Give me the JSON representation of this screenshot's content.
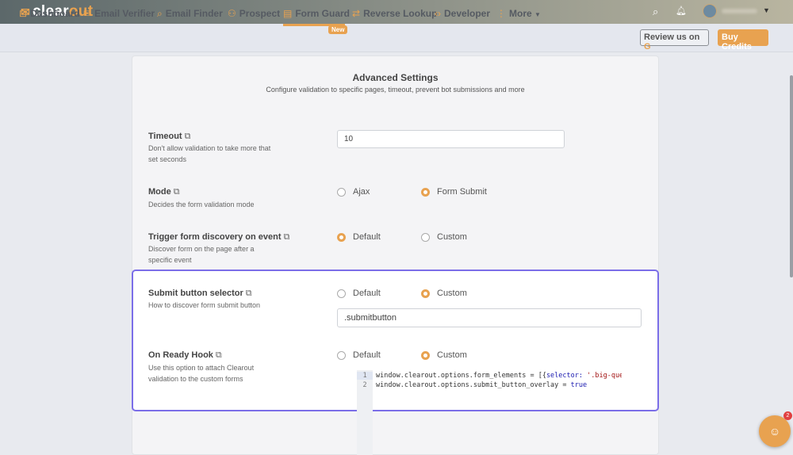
{
  "header": {
    "logo_a": "clear",
    "logo_b": "out",
    "search_icon": "search-icon",
    "bell_icon": "bell-icon"
  },
  "nav": {
    "items": [
      {
        "label": "Dashboard",
        "icon": "briefcase-icon"
      },
      {
        "label": "Email Verifier",
        "icon": "envelope-icon"
      },
      {
        "label": "Email Finder",
        "icon": "search-icon"
      },
      {
        "label": "Prospect",
        "icon": "users-icon"
      },
      {
        "label": "Form Guard",
        "icon": "form-icon",
        "badge": "New",
        "active": true
      },
      {
        "label": "Reverse Lookup",
        "icon": "swap-icon"
      },
      {
        "label": "Developer",
        "icon": "code-icon"
      },
      {
        "label": "More",
        "icon": "dots-icon"
      }
    ],
    "review": "Review us on",
    "buy": "Buy Credits"
  },
  "page": {
    "title": "Advanced Settings",
    "subtitle": "Configure validation to specific pages, timeout, prevent bot submissions and more"
  },
  "settings": {
    "timeout": {
      "label": "Timeout",
      "desc": "Don't allow validation to take more that set seconds",
      "value": "10"
    },
    "mode": {
      "label": "Mode",
      "desc": "Decides the form validation mode",
      "opt1": "Ajax",
      "opt2": "Form Submit",
      "selected": "Form Submit"
    },
    "trigger": {
      "label": "Trigger form discovery on event",
      "desc": "Discover form on the page after a specific event",
      "opt1": "Default",
      "opt2": "Custom",
      "selected": "Default"
    },
    "submit": {
      "label": "Submit button selector",
      "desc": "How to discover form submit button",
      "opt1": "Default",
      "opt2": "Custom",
      "selected": "Custom",
      "value": ".submitbutton"
    },
    "ready": {
      "label": "On Ready Hook",
      "desc": "Use this option to attach Clearout validation to the custom forms",
      "opt1": "Default",
      "opt2": "Custom",
      "selected": "Custom",
      "code": {
        "l1n": "1",
        "l1a": "window.clearout.options.form_elements = [{",
        "l1b": "selector:",
        "l1c": " '.big-questi",
        "l2n": "2",
        "l2a": "window.clearout.options.submit_button_overlay = ",
        "l2b": "true"
      }
    }
  },
  "chat": {
    "badge": "2"
  },
  "colors": {
    "accent": "#e8a250",
    "highlight": "#7b6ee8"
  }
}
